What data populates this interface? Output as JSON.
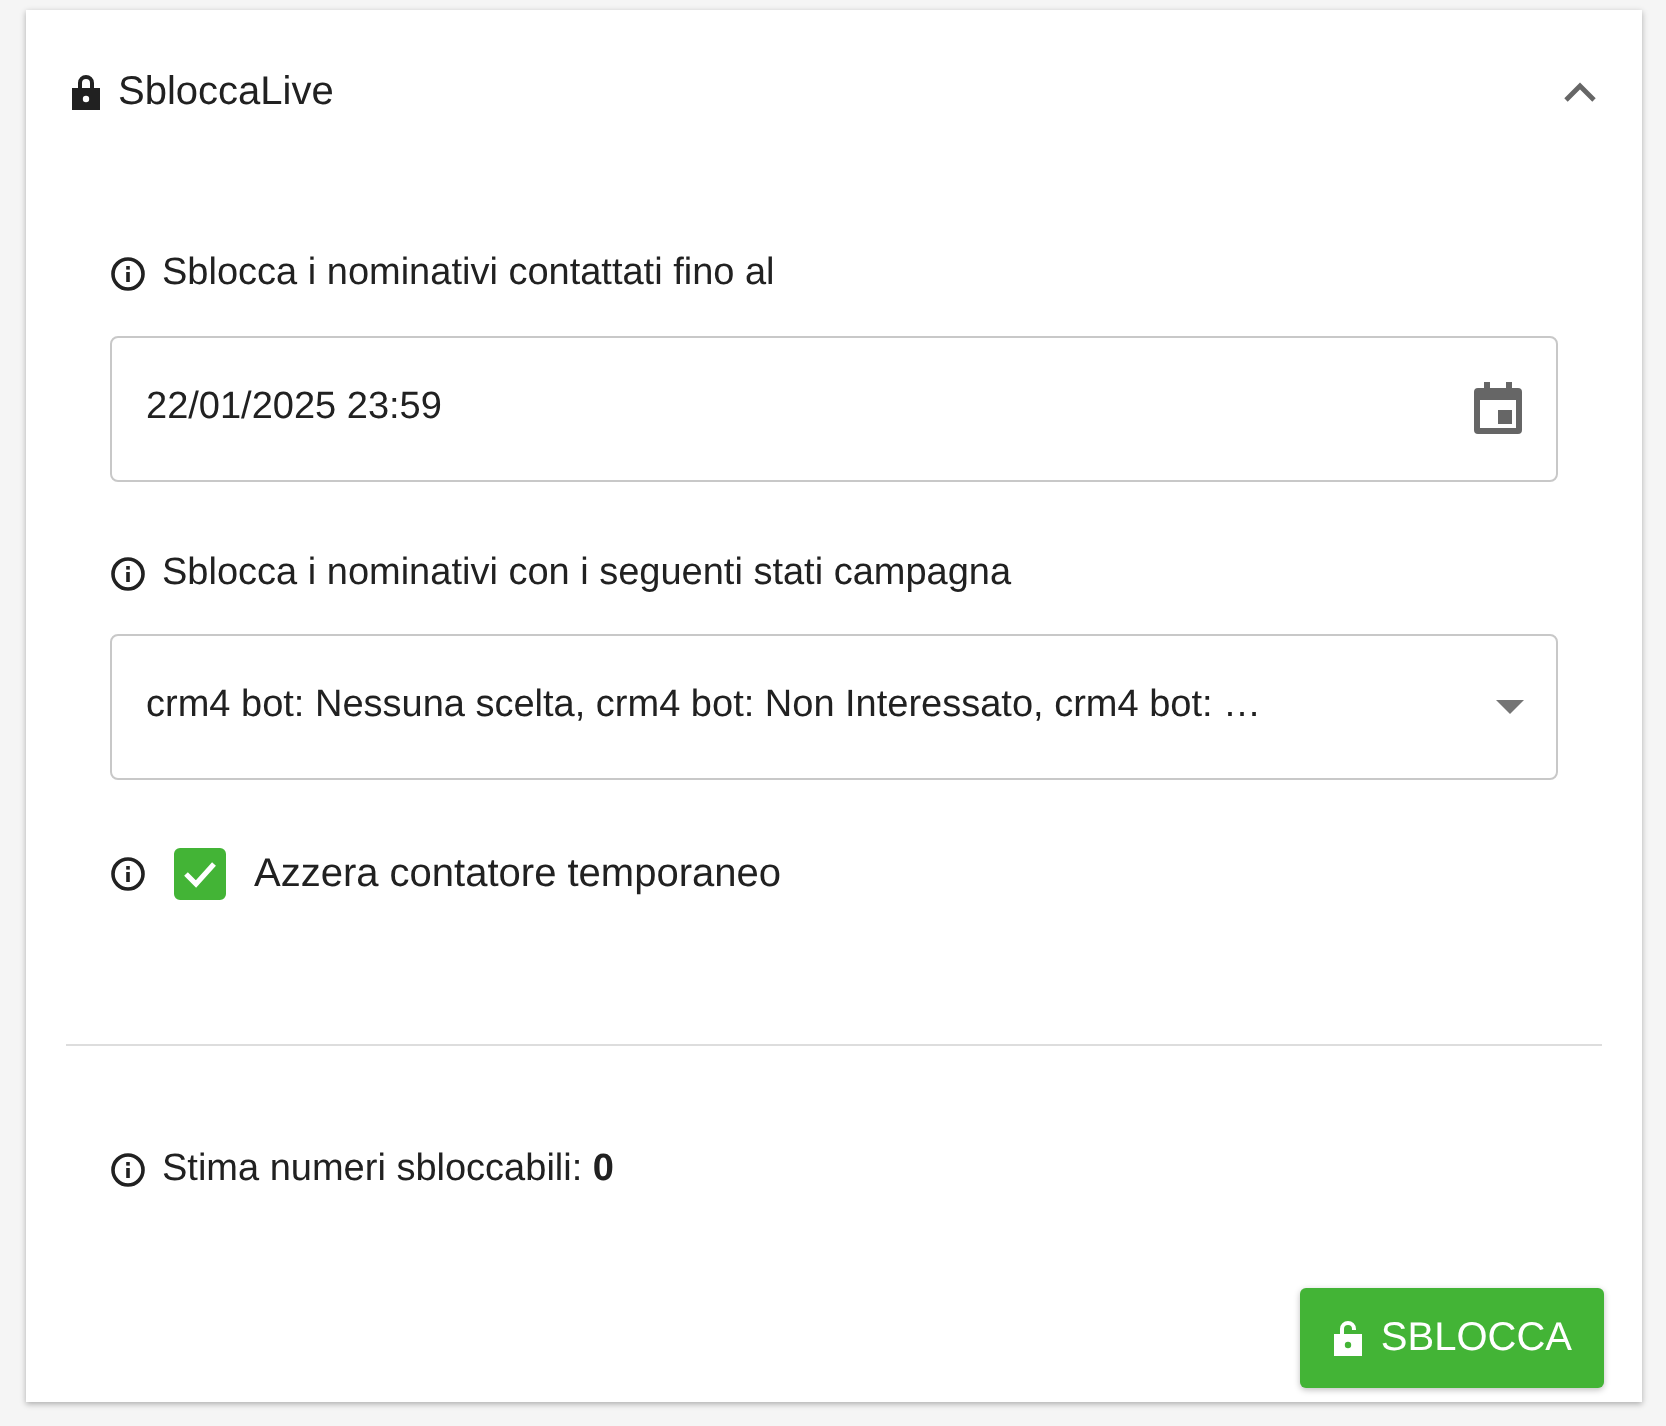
{
  "panel": {
    "title": "SbloccaLive",
    "expanded": true
  },
  "date_field": {
    "label": "Sblocca i nominativi contattati fino al",
    "value": "22/01/2025 23:59"
  },
  "status_select": {
    "label": "Sblocca i nominativi con i seguenti stati campagna",
    "value": "crm4 bot: Nessuna scelta, crm4 bot: Non Interessato, crm4 bot: …"
  },
  "reset_checkbox": {
    "label": "Azzera contatore temporaneo",
    "checked": true
  },
  "estimate": "Stima numeri sbloccabili: **0**",
  "unlock_button": "SBLOCCA"
}
